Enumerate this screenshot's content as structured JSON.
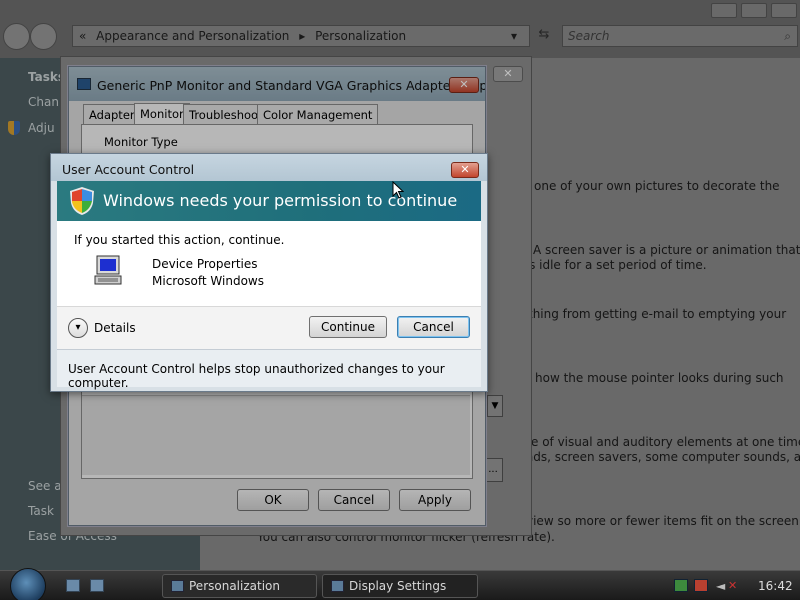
{
  "explorer": {
    "breadcrumb_prefix": "«",
    "breadcrumb": [
      "Appearance and Personalization",
      "Personalization"
    ],
    "search_placeholder": "Search"
  },
  "taskpane": {
    "items": [
      "Tasks",
      "Chan",
      "Adju",
      "See a",
      "Task",
      "Ease of Access"
    ]
  },
  "personalization": {
    "lines": [
      "one of your own pictures to decorate the",
      "A screen saver is a picture or animation that",
      "r is idle for a set period of time.",
      "thing from getting e-mail to emptying your",
      "how the mouse pointer looks during such",
      "e of visual and auditory elements at one time",
      "unds, screen savers, some computer sounds, and",
      "view so more or fewer items fit on the screen.",
      "You can also control monitor flicker (refresh rate)."
    ]
  },
  "properties": {
    "title": "Generic PnP Monitor and Standard VGA Graphics Adapter Prope...",
    "tabs": [
      "Adapter",
      "Monitor",
      "Troubleshoot",
      "Color Management"
    ],
    "selected_tab": "Monitor",
    "group_label": "Monitor Type",
    "ok_label": "OK",
    "cancel_label": "Cancel",
    "apply_label": "Apply"
  },
  "uac": {
    "title": "User Account Control",
    "banner": "Windows needs your permission to continue",
    "intro": "If you started this action, continue.",
    "program_name": "Device Properties",
    "publisher": "Microsoft Windows",
    "details_label": "Details",
    "continue_label": "Continue",
    "cancel_label": "Cancel",
    "footer": "User Account Control helps stop unauthorized changes to your computer."
  },
  "taskbar": {
    "buttons": [
      "Personalization",
      "Display Settings"
    ],
    "clock": "16:42"
  },
  "colors": {
    "banner": "#1f6f7b",
    "close_button": "#c2452d"
  },
  "icons": [
    "back-icon",
    "forward-icon",
    "search-icon",
    "shield-icon",
    "computer-icon",
    "chevron-down-icon",
    "close-icon",
    "start-orb-icon"
  ]
}
